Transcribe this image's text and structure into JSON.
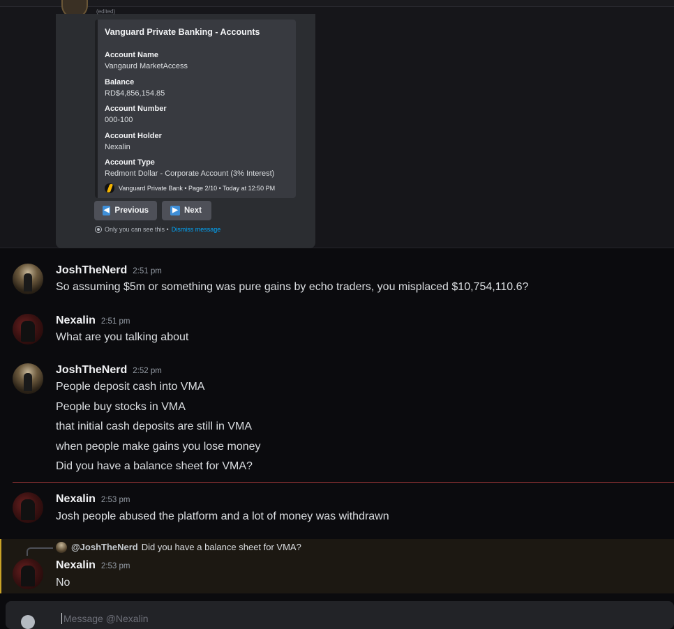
{
  "embed": {
    "edited_label": "(edited)",
    "title": "Vanguard Private Banking - Accounts",
    "fields": [
      {
        "name": "Account Name",
        "value": "Vangaurd MarketAccess"
      },
      {
        "name": "Balance",
        "value": "RD$4,856,154.85"
      },
      {
        "name": "Account Number",
        "value": "000-100"
      },
      {
        "name": "Account Holder",
        "value": "Nexalin"
      },
      {
        "name": "Account Type",
        "value": "Redmont Dollar - Corporate Account (3% Interest)"
      }
    ],
    "footer": "Vanguard Private Bank • Page 2/10 • Today at 12:50 PM",
    "buttons": {
      "previous": "Previous",
      "next": "Next"
    },
    "ephemeral_text": "Only you can see this •",
    "dismiss_label": "Dismiss message"
  },
  "messages": [
    {
      "author": "JoshTheNerd",
      "time": "2:51 pm",
      "lines": [
        "So assuming $5m or something was pure gains by echo traders, you misplaced $10,754,110.6?"
      ]
    },
    {
      "author": "Nexalin",
      "time": "2:51 pm",
      "lines": [
        "What are you talking about"
      ]
    },
    {
      "author": "JoshTheNerd",
      "time": "2:52 pm",
      "lines": [
        "People deposit cash into VMA",
        "People buy stocks in VMA",
        "that initial cash deposits are still in VMA",
        "when people make gains you lose money",
        "Did you have a balance sheet for VMA?"
      ]
    },
    {
      "author": "Nexalin",
      "time": "2:53 pm",
      "lines": [
        "Josh people abused the platform and a lot of money was withdrawn"
      ]
    },
    {
      "author": "Nexalin",
      "time": "2:53 pm",
      "lines": [
        "No"
      ]
    }
  ],
  "reply": {
    "user": "@JoshTheNerd",
    "text": "Did you have a balance sheet for VMA?"
  },
  "composer": {
    "placeholder": "Message @Nexalin"
  },
  "colors": {
    "accent_link": "#00a8fc",
    "new_divider": "#a63a3a",
    "mention_highlight": "#c9a227"
  }
}
